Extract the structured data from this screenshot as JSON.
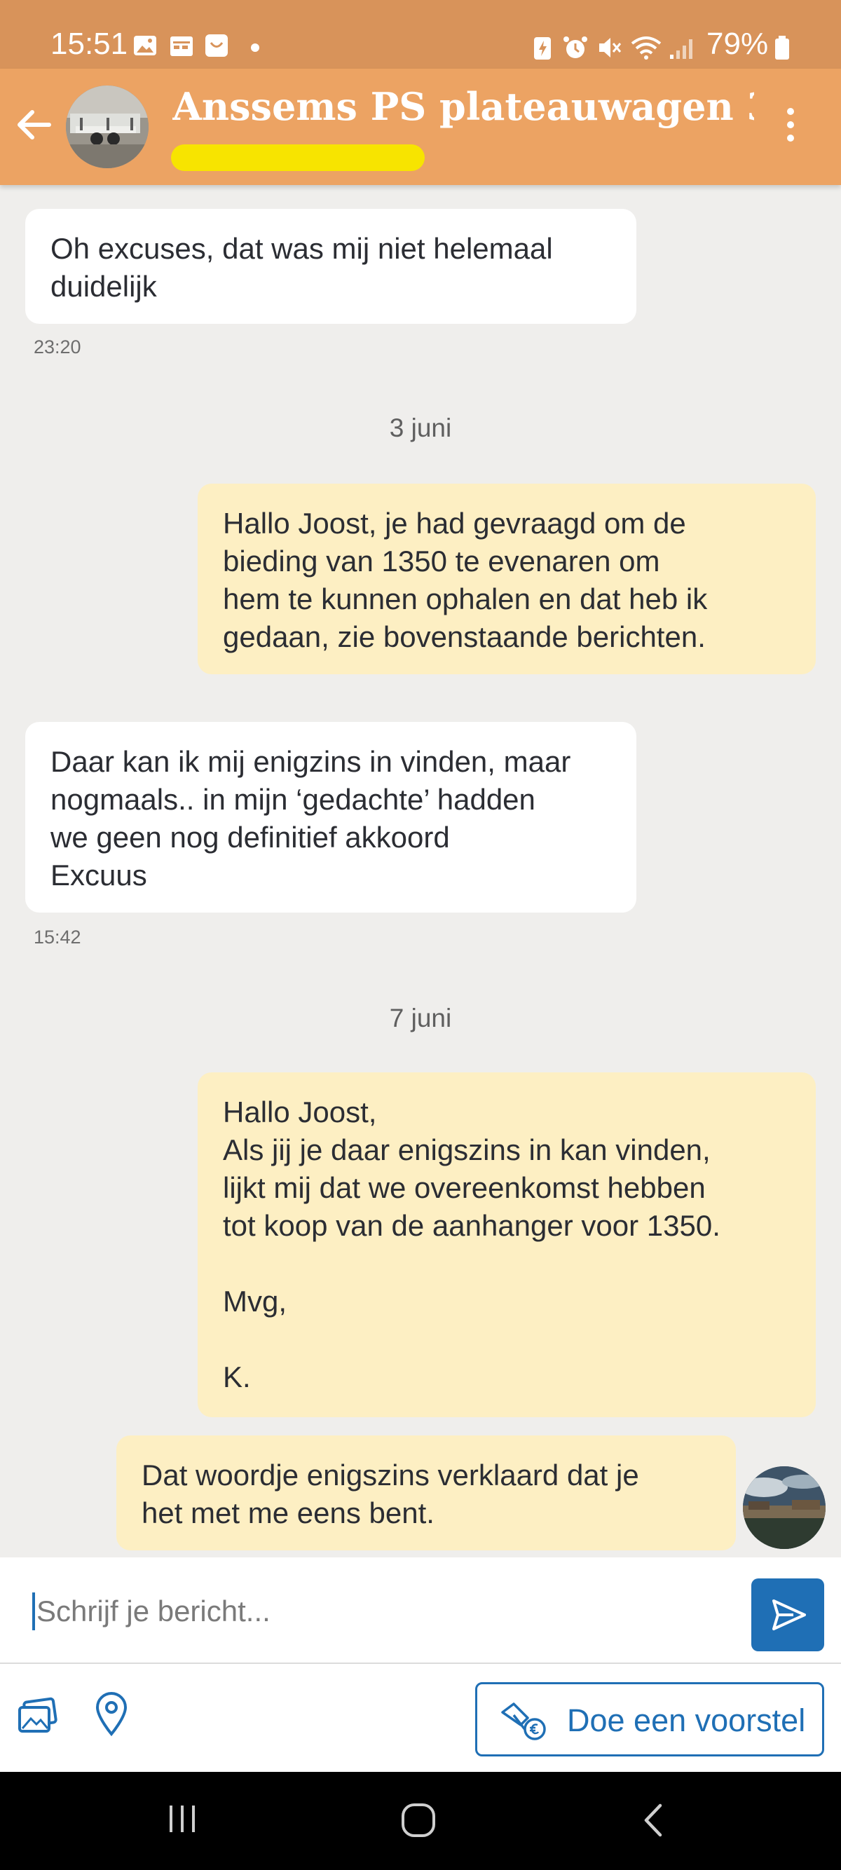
{
  "status_bar": {
    "time": "15:51",
    "battery": "79%",
    "icons": [
      "gallery-icon",
      "calendar-icon",
      "app-icon",
      "battery-saver-icon",
      "alarm-icon",
      "mute-icon",
      "wifi-icon",
      "signal-icon",
      "battery-icon"
    ]
  },
  "header": {
    "title": "Anssems PS plateauwagen 3...",
    "subtitle": "",
    "colors": {
      "background": "#eca363",
      "subtitle_highlight": "#f7e400"
    }
  },
  "messages": [
    {
      "type": "incoming",
      "text": "Oh excuses, dat was mij niet helemaal\nduidelijk",
      "time": "23:20"
    },
    {
      "type": "date",
      "text": "3 juni"
    },
    {
      "type": "outgoing",
      "text": "Hallo Joost, je had gevraagd om de\nbieding van 1350 te evenaren om\nhem te kunnen ophalen en dat heb ik\ngedaan, zie bovenstaande berichten."
    },
    {
      "type": "incoming",
      "text": "Daar kan ik mij enigzins in vinden, maar\nnogmaals.. in mijn ‘gedachte’ hadden\nwe geen nog definitief akkoord\nExcuus",
      "time": "15:42"
    },
    {
      "type": "date",
      "text": "7 juni"
    },
    {
      "type": "outgoing",
      "text": "Hallo Joost,\nAls jij je daar enigszins in kan vinden,\nlijkt mij dat we overeenkomst hebben\ntot koop van de aanhanger voor 1350.\n\nMvg,\n\nK."
    },
    {
      "type": "outgoing",
      "text": "Dat woordje enigszins verklaard dat je\nhet met me eens bent."
    }
  ],
  "composer": {
    "placeholder": "Schrijf je bericht...",
    "send_icon": "send-icon",
    "photo_icon": "photo-icon",
    "location_icon": "location-pin-icon",
    "offer_label": "Doe een voorstel",
    "accent": "#1f6fb5"
  },
  "nav_bar": {
    "items": [
      "recent-apps-icon",
      "home-icon",
      "back-nav-icon"
    ]
  }
}
